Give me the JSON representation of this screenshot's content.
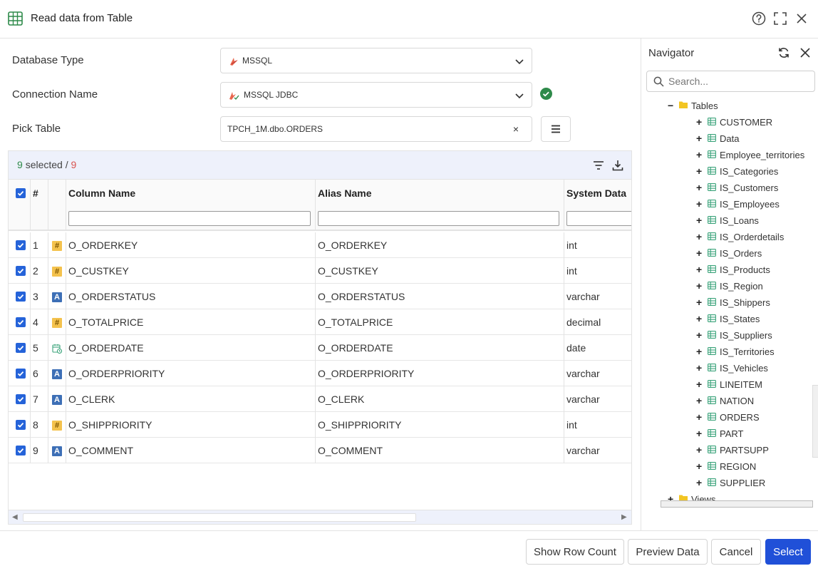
{
  "window": {
    "title": "Read data from Table"
  },
  "form": {
    "database_type_label": "Database Type",
    "database_type_value": "MSSQL",
    "connection_name_label": "Connection Name",
    "connection_name_value": "MSSQL JDBC",
    "pick_table_label": "Pick Table",
    "pick_table_value": "TPCH_1M.dbo.ORDERS",
    "clear_symbol": "×"
  },
  "grid": {
    "selected_count": "9",
    "selected_label": "selected /",
    "total_count": "9",
    "header_hash": "#",
    "columns": [
      "Column Name",
      "Alias Name",
      "System Data"
    ],
    "rows": [
      {
        "n": "1",
        "type": "num",
        "column": "O_ORDERKEY",
        "alias": "O_ORDERKEY",
        "dtype": "int"
      },
      {
        "n": "2",
        "type": "num",
        "column": "O_CUSTKEY",
        "alias": "O_CUSTKEY",
        "dtype": "int"
      },
      {
        "n": "3",
        "type": "str",
        "column": "O_ORDERSTATUS",
        "alias": "O_ORDERSTATUS",
        "dtype": "varchar"
      },
      {
        "n": "4",
        "type": "num",
        "column": "O_TOTALPRICE",
        "alias": "O_TOTALPRICE",
        "dtype": "decimal"
      },
      {
        "n": "5",
        "type": "date",
        "column": "O_ORDERDATE",
        "alias": "O_ORDERDATE",
        "dtype": "date"
      },
      {
        "n": "6",
        "type": "str",
        "column": "O_ORDERPRIORITY",
        "alias": "O_ORDERPRIORITY",
        "dtype": "varchar"
      },
      {
        "n": "7",
        "type": "str",
        "column": "O_CLERK",
        "alias": "O_CLERK",
        "dtype": "varchar"
      },
      {
        "n": "8",
        "type": "num",
        "column": "O_SHIPPRIORITY",
        "alias": "O_SHIPPRIORITY",
        "dtype": "int"
      },
      {
        "n": "9",
        "type": "str",
        "column": "O_COMMENT",
        "alias": "O_COMMENT",
        "dtype": "varchar"
      }
    ],
    "type_glyphs": {
      "num": "#",
      "str": "A"
    }
  },
  "navigator": {
    "title": "Navigator",
    "search_placeholder": "Search...",
    "tables_folder": "Tables",
    "expand_symbol": "+",
    "collapse_symbol": "−",
    "tables": [
      "CUSTOMER",
      "Data",
      "Employee_territories",
      "IS_Categories",
      "IS_Customers",
      "IS_Employees",
      "IS_Loans",
      "IS_Orderdetails",
      "IS_Orders",
      "IS_Products",
      "IS_Region",
      "IS_Shippers",
      "IS_States",
      "IS_Suppliers",
      "IS_Territories",
      "IS_Vehicles",
      "LINEITEM",
      "NATION",
      "ORDERS",
      "PART",
      "PARTSUPP",
      "REGION",
      "SUPPLIER"
    ],
    "views_folder": "Views"
  },
  "footer": {
    "show_row_count": "Show Row Count",
    "preview_data": "Preview Data",
    "cancel": "Cancel",
    "select": "Select"
  },
  "colors": {
    "accent": "#2050d8",
    "checkbox": "#2563d9",
    "success": "#2e8a4a",
    "error_count": "#d9534f",
    "toolbar_bg": "#eef1fb",
    "table_icon": "#3aa37a"
  }
}
